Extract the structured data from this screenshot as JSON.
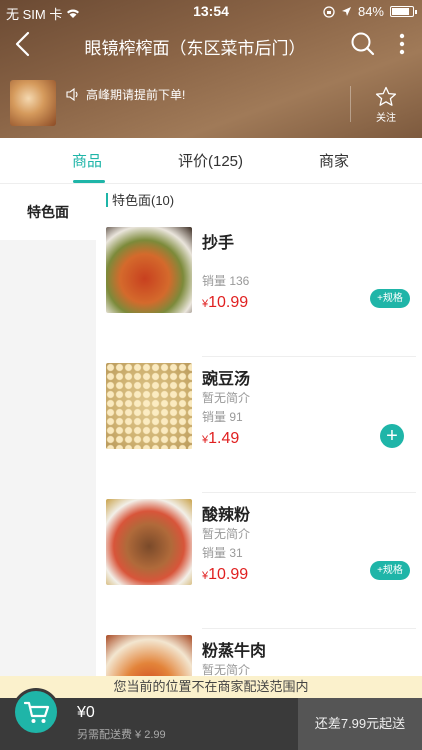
{
  "status": {
    "carrier": "无 SIM 卡",
    "time": "13:54",
    "battery": "84%",
    "battery_fraction": 0.84
  },
  "nav": {
    "title": "眼镜榨榨面（东区菜市后门）"
  },
  "shop": {
    "notice": "高峰期请提前下单!",
    "follow_label": "关注"
  },
  "tabs": [
    {
      "label": "商品",
      "active": true
    },
    {
      "label": "评价(125)",
      "active": false
    },
    {
      "label": "商家",
      "active": false
    }
  ],
  "sidebar": {
    "items": [
      {
        "label": "特色面",
        "active": true
      }
    ]
  },
  "category": {
    "title": "特色面(10)"
  },
  "items": [
    {
      "name": "抄手",
      "desc": "",
      "sales": "销量 136",
      "currency": "¥",
      "price": "10.99",
      "action": "+规格",
      "image": "chaoshou-bowl"
    },
    {
      "name": "豌豆汤",
      "desc": "暂无简介",
      "sales": "销量 91",
      "currency": "¥",
      "price": "1.49",
      "action": "+",
      "image": "peas"
    },
    {
      "name": "酸辣粉",
      "desc": "暂无简介",
      "sales": "销量 31",
      "currency": "¥",
      "price": "10.99",
      "action": "+规格",
      "image": "suanla-bowl"
    },
    {
      "name": "粉蒸牛肉",
      "desc": "暂无简介",
      "sales": "",
      "currency": "",
      "price": "",
      "action": "",
      "image": "fenzheng-bowl"
    }
  ],
  "notice": "您当前的位置不在商家配送范围内",
  "cart": {
    "amount": "¥0",
    "fee": "另需配送费 ¥ 2.99",
    "gap": "还差7.99元起送"
  },
  "colors": {
    "accent": "#1fb5a8",
    "price": "#e02020",
    "cart_bg": "#3a3a3a",
    "notice_bg": "#fbf1cc"
  }
}
